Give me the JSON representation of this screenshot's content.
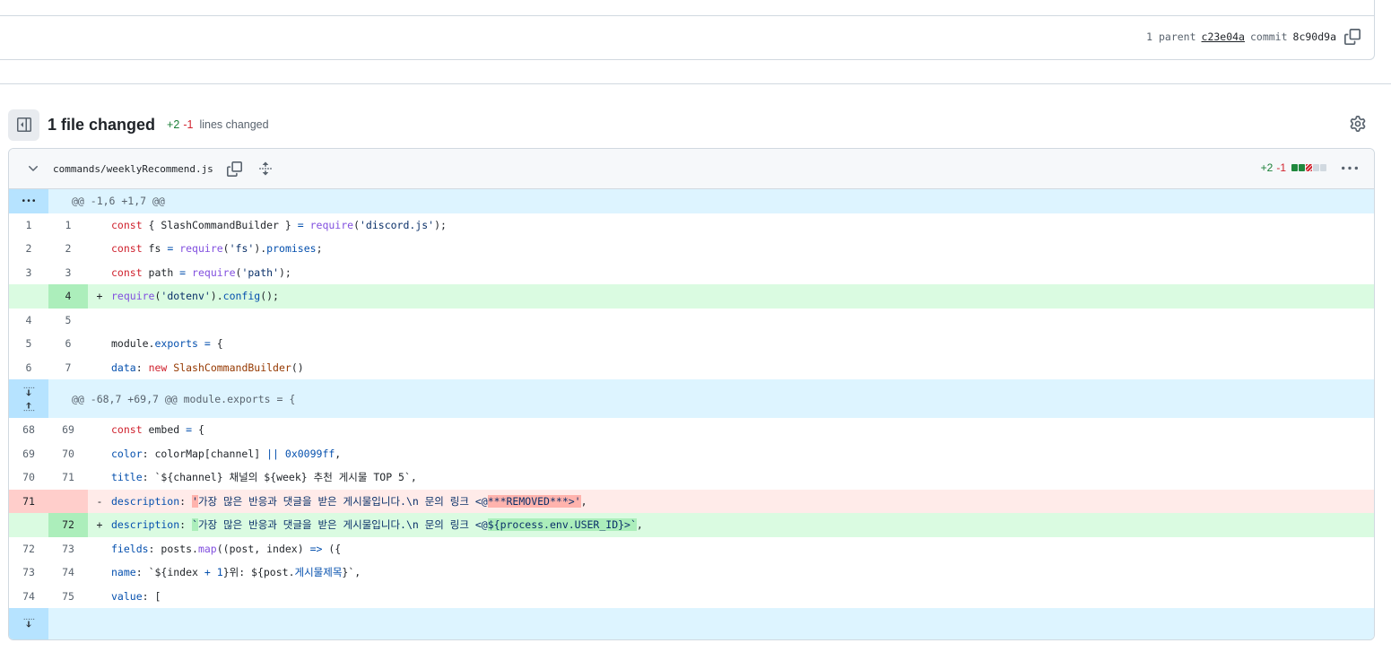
{
  "commit": {
    "parent_label": "1 parent",
    "parent_sha": "c23e04a",
    "commit_label": "commit",
    "commit_sha": "8c90d9a"
  },
  "summary": {
    "files_changed": "1 file changed",
    "additions": "+2",
    "deletions": "-1",
    "lines_changed": "lines changed"
  },
  "file": {
    "path": "commands/weeklyRecommend.js",
    "additions": "+2",
    "deletions": "-1"
  },
  "hunks": [
    {
      "header": "@@ -1,6 +1,7 @@"
    },
    {
      "header": "@@ -68,7 +69,7 @@ module.exports = {"
    }
  ],
  "lines": {
    "l1": {
      "old": "1",
      "new": "1"
    },
    "l2": {
      "old": "2",
      "new": "2"
    },
    "l3": {
      "old": "3",
      "new": "3"
    },
    "l4": {
      "old": "",
      "new": "4",
      "marker": "+"
    },
    "l5": {
      "old": "4",
      "new": "5"
    },
    "l6": {
      "old": "5",
      "new": "6"
    },
    "l7": {
      "old": "6",
      "new": "7"
    },
    "l8": {
      "old": "68",
      "new": "69"
    },
    "l9": {
      "old": "69",
      "new": "70"
    },
    "l10": {
      "old": "70",
      "new": "71"
    },
    "l11": {
      "old": "71",
      "new": "",
      "marker": "-"
    },
    "l12": {
      "old": "",
      "new": "72",
      "marker": "+"
    },
    "l13": {
      "old": "72",
      "new": "73"
    },
    "l14": {
      "old": "73",
      "new": "74"
    },
    "l15": {
      "old": "74",
      "new": "75"
    }
  },
  "code": {
    "c1": {
      "a": "const",
      "b": " { SlashCommandBuilder } ",
      "c": "=",
      "d": " ",
      "e": "require",
      "f": "(",
      "g": "'discord.js'",
      "h": ");"
    },
    "c2": {
      "a": "const",
      "b": " fs ",
      "c": "=",
      "d": " ",
      "e": "require",
      "f": "(",
      "g": "'fs'",
      "h": ").",
      "i": "promises",
      "j": ";"
    },
    "c3": {
      "a": "const",
      "b": " path ",
      "c": "=",
      "d": " ",
      "e": "require",
      "f": "(",
      "g": "'path'",
      "h": ");"
    },
    "c4": {
      "e": "require",
      "f": "(",
      "g": "'dotenv'",
      "h": ").",
      "i": "config",
      "j": "();"
    },
    "c6": {
      "a": "module",
      "b": ".",
      "c": "exports",
      "d": " ",
      "e": "=",
      "f": " {"
    },
    "c7": {
      "a": "data",
      "b": ": ",
      "c": "new",
      "d": " ",
      "e": "SlashCommandBuilder",
      "f": "()"
    },
    "c8": {
      "a": "const",
      "b": " embed ",
      "c": "=",
      "d": " {"
    },
    "c9": {
      "a": "color",
      "b": ": colorMap[channel] ",
      "c": "||",
      "d": " ",
      "e": "0x0099ff",
      "f": ","
    },
    "c10": {
      "a": "title",
      "b": ": ",
      "c": "`${channel} 채널의 ${week} 추천 게시물 TOP 5`",
      "d": ","
    },
    "c11": {
      "a": "description",
      "b": ": ",
      "c": "'",
      "d": "가장 많은 반응과 댓글을 받은 게시물입니다.\\n 문의 링크 <@",
      "e": "***REMOVED***>'",
      "f": ","
    },
    "c12": {
      "a": "description",
      "b": ": ",
      "c": "`",
      "d": "가장 많은 반응과 댓글을 받은 게시물입니다.\\n 문의 링크 <@",
      "e": "${process.env.USER_ID}>`",
      "f": ","
    },
    "c13": {
      "a": "fields",
      "b": ": posts.",
      "c": "map",
      "d": "((post, index) ",
      "e": "=>",
      "f": " ({"
    },
    "c14": {
      "a": "name",
      "b": ": ",
      "c": "`${index ",
      "d": "+",
      "e": " ",
      "f": "1",
      "g": "}위: ${post.",
      "h": "게시물제목",
      "i": "}`",
      "j": ","
    },
    "c15": {
      "a": "value",
      "b": ": ["
    }
  },
  "icons": {
    "tree_toggle": "sidebar-expand-icon",
    "settings": "gear-icon",
    "collapse": "chevron-down-icon",
    "copy": "copy-icon",
    "expand_all": "fold-icon",
    "more": "kebab-horizontal-icon",
    "expand_up": "expand-up-icon",
    "expand_down": "expand-down-icon"
  }
}
